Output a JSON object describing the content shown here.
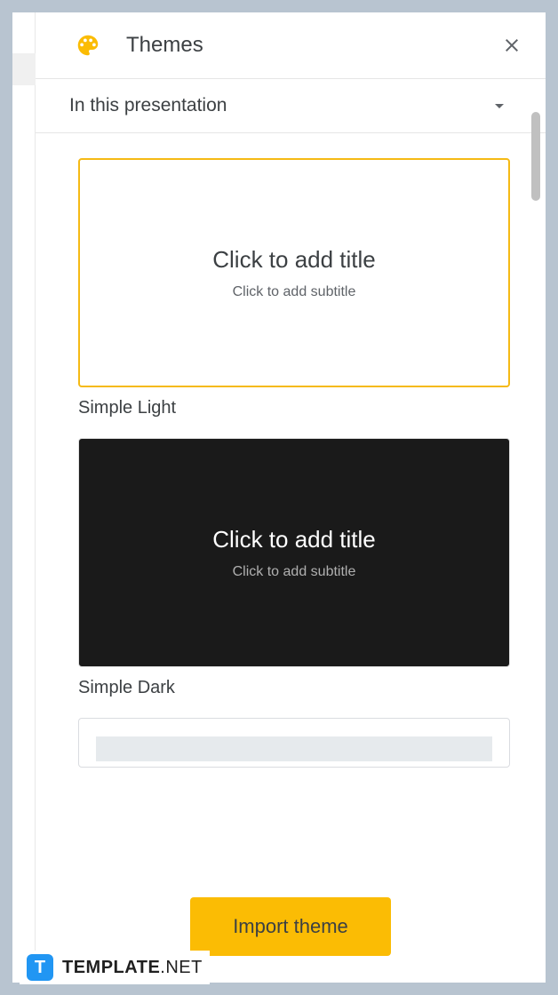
{
  "panel": {
    "title": "Themes"
  },
  "section": {
    "label": "In this presentation"
  },
  "themes": {
    "preview_title": "Click to add title",
    "preview_subtitle": "Click to add subtitle",
    "simple_light": "Simple Light",
    "simple_dark": "Simple Dark"
  },
  "footer": {
    "import_label": "Import theme"
  },
  "watermark": {
    "icon_letter": "T",
    "text_bold": "TEMPLATE",
    "text_light": ".NET"
  }
}
